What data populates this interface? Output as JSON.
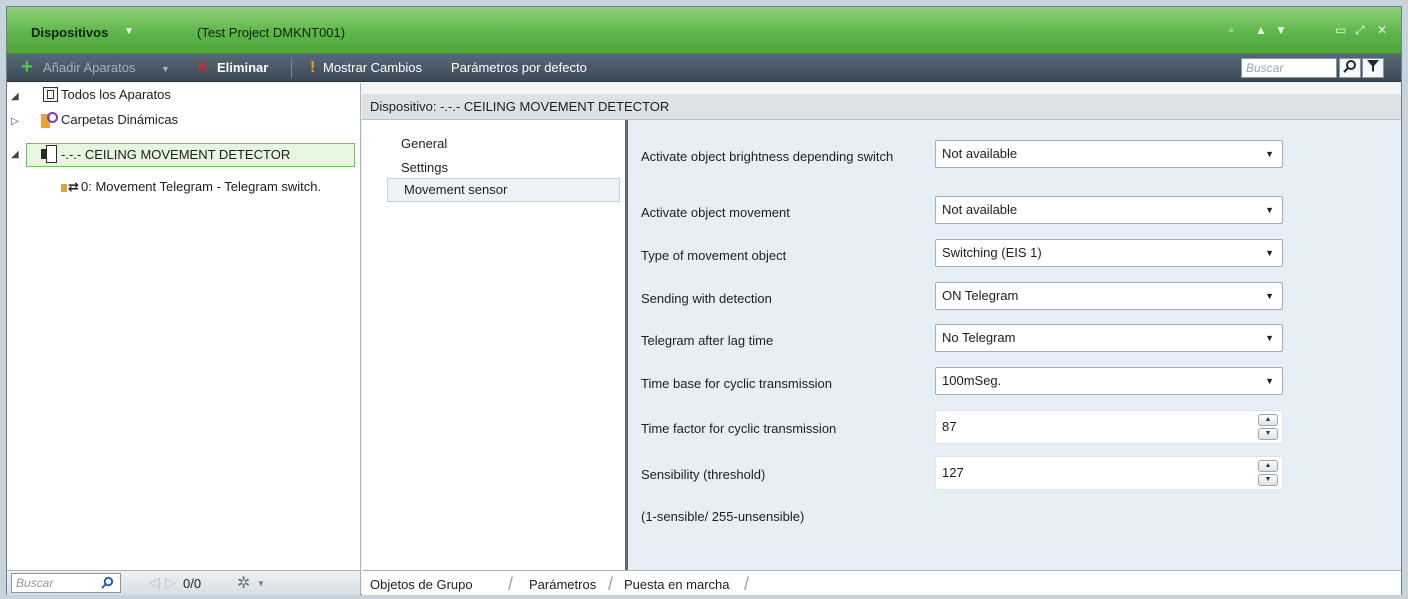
{
  "titlebar": {
    "title": "Dispositivos",
    "dropdown_glyph": "▼",
    "project": "(Test Project DMKNT001)"
  },
  "toolbar": {
    "add_label": "Añadir Aparatos",
    "add_dropdown_glyph": "▼",
    "delete_label": "Eliminar",
    "show_changes_label": "Mostrar Cambios",
    "default_params_label": "Parámetros por defecto",
    "search_placeholder": "Buscar"
  },
  "tree": {
    "items": [
      {
        "label": "Todos los Aparatos"
      },
      {
        "label": "Carpetas Dinámicas"
      },
      {
        "label": "-.-.-  CEILING MOVEMENT DETECTOR"
      },
      {
        "label": "0: Movement Telegram - Telegram switch."
      }
    ],
    "search_placeholder": "Buscar",
    "pager": "0/0"
  },
  "device": {
    "header": "Dispositivo: -.-.-  CEILING MOVEMENT DETECTOR"
  },
  "nav": {
    "items": [
      {
        "label": "General"
      },
      {
        "label": "Settings"
      },
      {
        "label": "Movement sensor"
      }
    ]
  },
  "params": [
    {
      "label": "Activate object brightness depending switch",
      "value": "Not available"
    },
    {
      "label": "Activate object movement",
      "value": "Not available"
    },
    {
      "label": "Type of movement object",
      "value": "Switching (EIS 1)"
    },
    {
      "label": "Sending with detection",
      "value": "ON Telegram"
    },
    {
      "label": "Telegram after lag time",
      "value": "No Telegram"
    },
    {
      "label": "Time base for cyclic transmission",
      "value": "100mSeg."
    },
    {
      "label": "Time factor for cyclic transmission",
      "value": "87"
    },
    {
      "label": "Sensibility (threshold)",
      "value": "127"
    }
  ],
  "note": "(1-sensible/ 255-unsensible)",
  "tabs": [
    {
      "label": "Objetos de Grupo"
    },
    {
      "label": "Parámetros"
    },
    {
      "label": "Puesta en marcha"
    }
  ],
  "colors": {
    "title_green": "#5fb64a",
    "toolbar_dark": "#3c4957",
    "selection_green": "#6cc45a"
  }
}
